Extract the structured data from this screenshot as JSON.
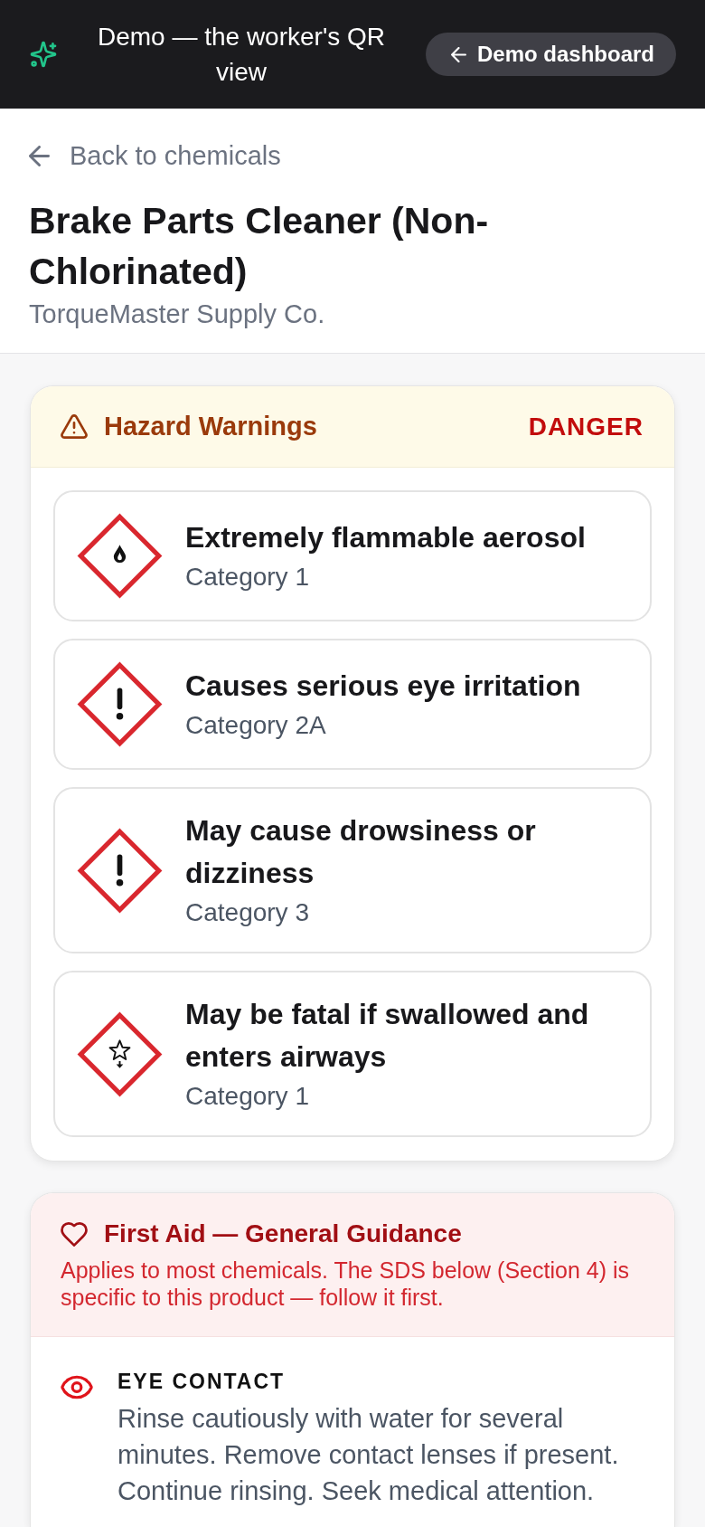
{
  "header": {
    "title": "Demo — the worker's QR view",
    "button": "Demo dashboard"
  },
  "back_link": "Back to chemicals",
  "product": {
    "name": "Brake Parts Cleaner (Non-Chlorinated)",
    "manufacturer": "TorqueMaster Supply Co."
  },
  "hazards": {
    "title": "Hazard Warnings",
    "signal_word": "DANGER",
    "items": [
      {
        "kind": "flame",
        "statement": "Extremely flammable aerosol",
        "category": "Category 1"
      },
      {
        "kind": "exclamation",
        "statement": "Causes serious eye irritation",
        "category": "Category 2A"
      },
      {
        "kind": "exclamation",
        "statement": "May cause drowsiness or dizziness",
        "category": "Category 3"
      },
      {
        "kind": "health",
        "statement": "May be fatal if swallowed and enters airways",
        "category": "Category 1"
      }
    ]
  },
  "first_aid": {
    "title": "First Aid — General Guidance",
    "note": "Applies to most chemicals. The SDS below (Section 4) is specific to this product — follow it first.",
    "items": [
      {
        "kind": "eye",
        "label": "EYE CONTACT",
        "text": "Rinse cautiously with water for several minutes. Remove contact lenses if present. Continue rinsing. Seek medical attention."
      }
    ]
  }
}
